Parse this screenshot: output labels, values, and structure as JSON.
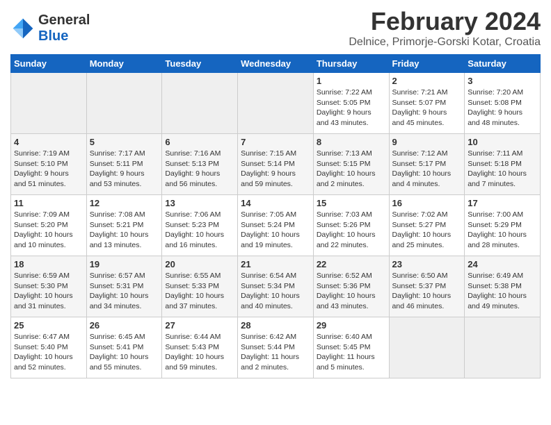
{
  "header": {
    "logo_general": "General",
    "logo_blue": "Blue",
    "month_title": "February 2024",
    "location": "Delnice, Primorje-Gorski Kotar, Croatia"
  },
  "days_of_week": [
    "Sunday",
    "Monday",
    "Tuesday",
    "Wednesday",
    "Thursday",
    "Friday",
    "Saturday"
  ],
  "weeks": [
    [
      {
        "day": "",
        "info": ""
      },
      {
        "day": "",
        "info": ""
      },
      {
        "day": "",
        "info": ""
      },
      {
        "day": "",
        "info": ""
      },
      {
        "day": "1",
        "info": "Sunrise: 7:22 AM\nSunset: 5:05 PM\nDaylight: 9 hours\nand 43 minutes."
      },
      {
        "day": "2",
        "info": "Sunrise: 7:21 AM\nSunset: 5:07 PM\nDaylight: 9 hours\nand 45 minutes."
      },
      {
        "day": "3",
        "info": "Sunrise: 7:20 AM\nSunset: 5:08 PM\nDaylight: 9 hours\nand 48 minutes."
      }
    ],
    [
      {
        "day": "4",
        "info": "Sunrise: 7:19 AM\nSunset: 5:10 PM\nDaylight: 9 hours\nand 51 minutes."
      },
      {
        "day": "5",
        "info": "Sunrise: 7:17 AM\nSunset: 5:11 PM\nDaylight: 9 hours\nand 53 minutes."
      },
      {
        "day": "6",
        "info": "Sunrise: 7:16 AM\nSunset: 5:13 PM\nDaylight: 9 hours\nand 56 minutes."
      },
      {
        "day": "7",
        "info": "Sunrise: 7:15 AM\nSunset: 5:14 PM\nDaylight: 9 hours\nand 59 minutes."
      },
      {
        "day": "8",
        "info": "Sunrise: 7:13 AM\nSunset: 5:15 PM\nDaylight: 10 hours\nand 2 minutes."
      },
      {
        "day": "9",
        "info": "Sunrise: 7:12 AM\nSunset: 5:17 PM\nDaylight: 10 hours\nand 4 minutes."
      },
      {
        "day": "10",
        "info": "Sunrise: 7:11 AM\nSunset: 5:18 PM\nDaylight: 10 hours\nand 7 minutes."
      }
    ],
    [
      {
        "day": "11",
        "info": "Sunrise: 7:09 AM\nSunset: 5:20 PM\nDaylight: 10 hours\nand 10 minutes."
      },
      {
        "day": "12",
        "info": "Sunrise: 7:08 AM\nSunset: 5:21 PM\nDaylight: 10 hours\nand 13 minutes."
      },
      {
        "day": "13",
        "info": "Sunrise: 7:06 AM\nSunset: 5:23 PM\nDaylight: 10 hours\nand 16 minutes."
      },
      {
        "day": "14",
        "info": "Sunrise: 7:05 AM\nSunset: 5:24 PM\nDaylight: 10 hours\nand 19 minutes."
      },
      {
        "day": "15",
        "info": "Sunrise: 7:03 AM\nSunset: 5:26 PM\nDaylight: 10 hours\nand 22 minutes."
      },
      {
        "day": "16",
        "info": "Sunrise: 7:02 AM\nSunset: 5:27 PM\nDaylight: 10 hours\nand 25 minutes."
      },
      {
        "day": "17",
        "info": "Sunrise: 7:00 AM\nSunset: 5:29 PM\nDaylight: 10 hours\nand 28 minutes."
      }
    ],
    [
      {
        "day": "18",
        "info": "Sunrise: 6:59 AM\nSunset: 5:30 PM\nDaylight: 10 hours\nand 31 minutes."
      },
      {
        "day": "19",
        "info": "Sunrise: 6:57 AM\nSunset: 5:31 PM\nDaylight: 10 hours\nand 34 minutes."
      },
      {
        "day": "20",
        "info": "Sunrise: 6:55 AM\nSunset: 5:33 PM\nDaylight: 10 hours\nand 37 minutes."
      },
      {
        "day": "21",
        "info": "Sunrise: 6:54 AM\nSunset: 5:34 PM\nDaylight: 10 hours\nand 40 minutes."
      },
      {
        "day": "22",
        "info": "Sunrise: 6:52 AM\nSunset: 5:36 PM\nDaylight: 10 hours\nand 43 minutes."
      },
      {
        "day": "23",
        "info": "Sunrise: 6:50 AM\nSunset: 5:37 PM\nDaylight: 10 hours\nand 46 minutes."
      },
      {
        "day": "24",
        "info": "Sunrise: 6:49 AM\nSunset: 5:38 PM\nDaylight: 10 hours\nand 49 minutes."
      }
    ],
    [
      {
        "day": "25",
        "info": "Sunrise: 6:47 AM\nSunset: 5:40 PM\nDaylight: 10 hours\nand 52 minutes."
      },
      {
        "day": "26",
        "info": "Sunrise: 6:45 AM\nSunset: 5:41 PM\nDaylight: 10 hours\nand 55 minutes."
      },
      {
        "day": "27",
        "info": "Sunrise: 6:44 AM\nSunset: 5:43 PM\nDaylight: 10 hours\nand 59 minutes."
      },
      {
        "day": "28",
        "info": "Sunrise: 6:42 AM\nSunset: 5:44 PM\nDaylight: 11 hours\nand 2 minutes."
      },
      {
        "day": "29",
        "info": "Sunrise: 6:40 AM\nSunset: 5:45 PM\nDaylight: 11 hours\nand 5 minutes."
      },
      {
        "day": "",
        "info": ""
      },
      {
        "day": "",
        "info": ""
      }
    ]
  ]
}
